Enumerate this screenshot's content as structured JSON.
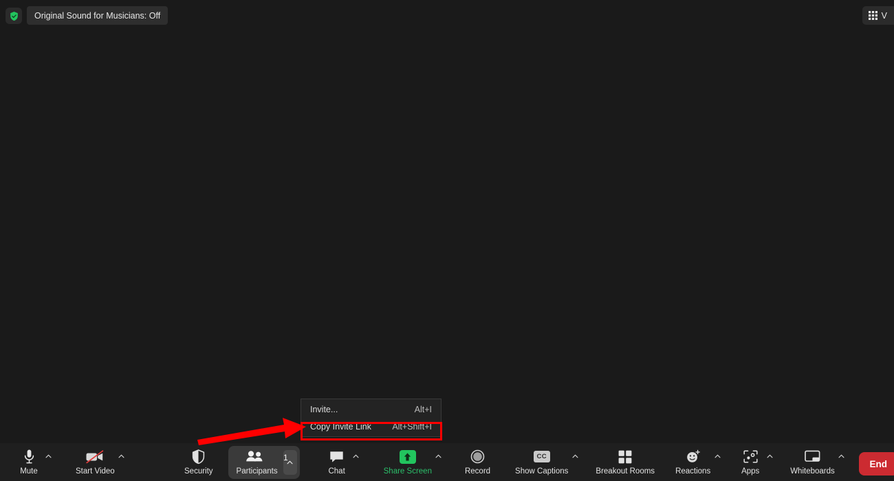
{
  "topbar": {
    "shield_icon": "shield-check-icon",
    "original_sound_label": "Original Sound for Musicians: Off",
    "view_icon": "grid-view-icon",
    "view_label": "V"
  },
  "context_menu": {
    "items": [
      {
        "label": "Invite...",
        "shortcut": "Alt+I",
        "highlighted": false
      },
      {
        "label": "Copy Invite Link",
        "shortcut": "Alt+Shift+I",
        "highlighted": true
      }
    ]
  },
  "annotation": {
    "arrow_color": "#ff0000",
    "highlight_color": "#ff0000",
    "points_to": "Copy Invite Link"
  },
  "toolbar": {
    "mute": {
      "label": "Mute",
      "icon": "microphone-icon",
      "caret": true
    },
    "start_video": {
      "label": "Start Video",
      "icon": "video-off-icon",
      "caret": true
    },
    "security": {
      "label": "Security",
      "icon": "shield-icon",
      "caret": false
    },
    "participants": {
      "label": "Participants",
      "icon": "people-icon",
      "count": "1",
      "caret": true,
      "active": true
    },
    "chat": {
      "label": "Chat",
      "icon": "chat-bubble-icon",
      "caret": true
    },
    "share_screen": {
      "label": "Share Screen",
      "icon": "share-arrow-up-icon",
      "caret": true,
      "accent": "#2bbf6a"
    },
    "record": {
      "label": "Record",
      "icon": "record-circle-icon",
      "caret": false
    },
    "show_captions": {
      "label": "Show Captions",
      "icon": "cc-icon",
      "badge": "CC",
      "caret": true
    },
    "breakout_rooms": {
      "label": "Breakout Rooms",
      "icon": "grid-squares-icon",
      "caret": false
    },
    "reactions": {
      "label": "Reactions",
      "icon": "smiley-plus-icon",
      "caret": true
    },
    "apps": {
      "label": "Apps",
      "icon": "apps-bracket-icon",
      "caret": true
    },
    "whiteboards": {
      "label": "Whiteboards",
      "icon": "whiteboard-icon",
      "caret": true
    },
    "end": {
      "label": "End",
      "color": "#cc2b31"
    }
  }
}
